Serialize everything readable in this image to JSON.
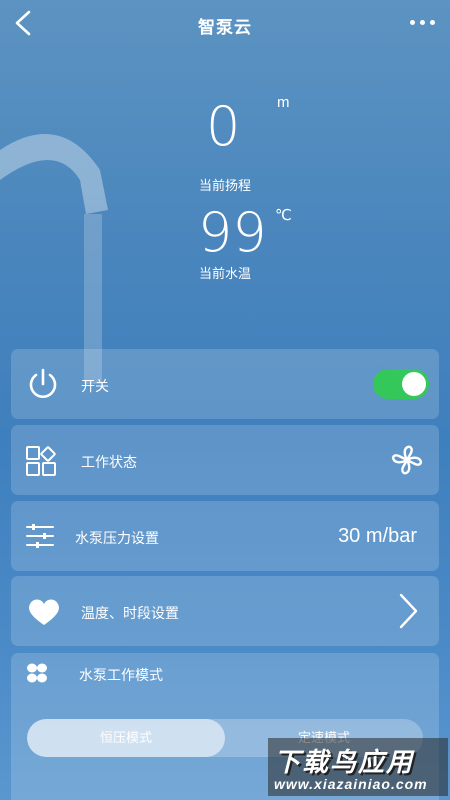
{
  "header": {
    "title": "智泵云"
  },
  "metrics": {
    "head": {
      "value": "0",
      "unit": "m",
      "label": "当前扬程"
    },
    "temperature": {
      "value": "99",
      "unit": "℃",
      "label": "当前水温"
    }
  },
  "cards": {
    "power": {
      "label": "开关",
      "enabled": true
    },
    "work_status": {
      "label": "工作状态"
    },
    "pressure": {
      "label": "水泵压力设置",
      "value": "30 m/bar"
    },
    "temp_time": {
      "label": "温度、时段设置"
    },
    "mode": {
      "label": "水泵工作模式",
      "options": [
        "恒压模式",
        "定速模式"
      ],
      "selected": "恒压模式"
    }
  },
  "watermark": {
    "title": "下载鸟应用",
    "url": "www.xiazainiao.com"
  },
  "colors": {
    "toggle_on": "#34c759",
    "background": "#4a86bd"
  }
}
